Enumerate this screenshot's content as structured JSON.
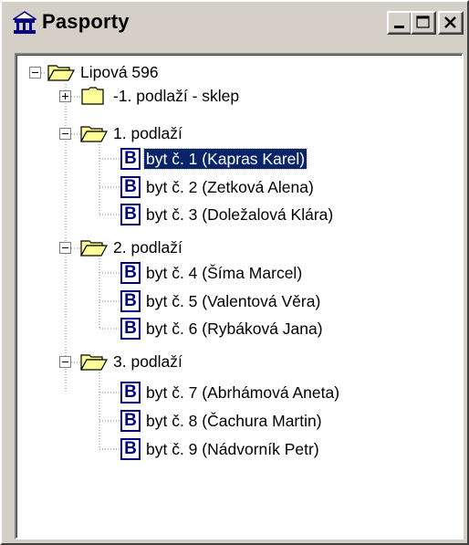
{
  "window": {
    "title": "Pasporty",
    "app_icon": "home-icon",
    "controls": [
      "minimize-icon",
      "maximize-icon",
      "close-icon"
    ]
  },
  "tree": {
    "root": {
      "label": "Lipová 596",
      "expanded": true
    },
    "floors": [
      {
        "label": "-1. podlaží - sklep",
        "expanded": false,
        "units": []
      },
      {
        "label": "1. podlaží",
        "expanded": true,
        "units": [
          {
            "label": "byt č. 1 (Kapras Karel)",
            "selected": true
          },
          {
            "label": "byt č. 2 (Zetková Alena)",
            "selected": false
          },
          {
            "label": "byt č. 3 (Doležalová Klára)",
            "selected": false
          }
        ]
      },
      {
        "label": "2. podlaží",
        "expanded": true,
        "units": [
          {
            "label": "byt č. 4 (Šíma Marcel)",
            "selected": false
          },
          {
            "label": "byt č. 5 (Valentová Věra)",
            "selected": false
          },
          {
            "label": "byt č. 6 (Rybáková Jana)",
            "selected": false
          }
        ]
      },
      {
        "label": "3. podlaží",
        "expanded": true,
        "units": [
          {
            "label": "byt č. 7 (Abrhámová Aneta)",
            "selected": false
          },
          {
            "label": "byt č. 8 (Čachura Martin)",
            "selected": false
          },
          {
            "label": "byt č. 9 (Nádvorník Petr)",
            "selected": false
          }
        ]
      }
    ],
    "unit_icon_letter": "B"
  },
  "colors": {
    "selection": "#0a246a",
    "unit_icon": "#000080",
    "folder": "#ffff99"
  }
}
